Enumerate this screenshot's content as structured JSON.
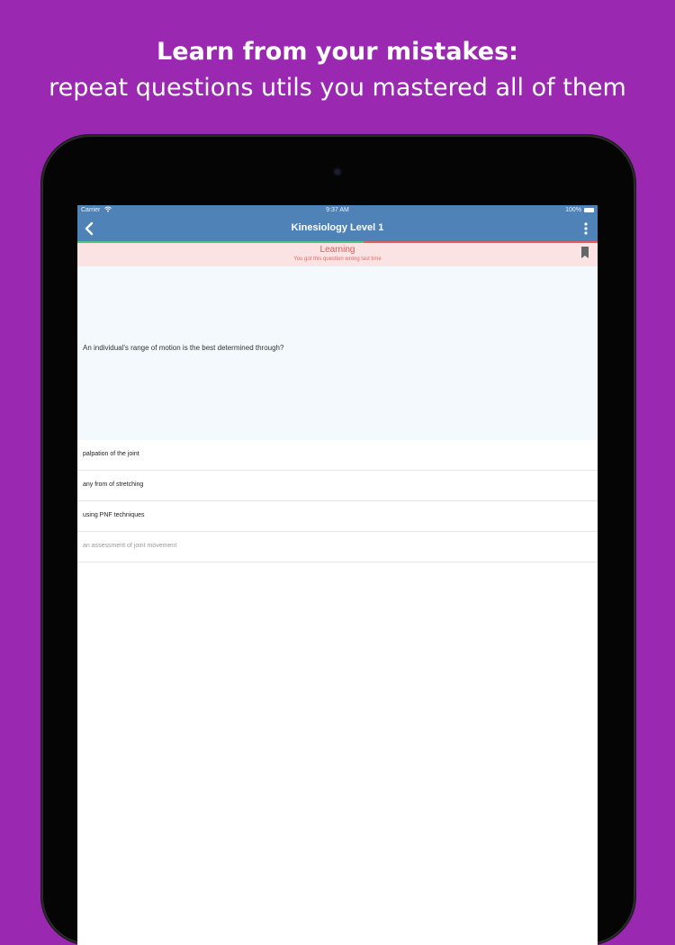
{
  "headline": {
    "title": "Learn from your mistakes:",
    "subtitle": "repeat questions utils you mastered all of them"
  },
  "status_bar": {
    "carrier": "Carrier",
    "wifi_icon": "wifi-icon",
    "time": "9:37 AM",
    "battery": "100%"
  },
  "nav": {
    "back_icon": "chevron-left-icon",
    "title": "Kinesiology Level 1",
    "more_icon": "more-vertical-icon"
  },
  "progress": {
    "fraction": 0.55,
    "done_color": "#49c58b",
    "remaining_color": "#e65a5a"
  },
  "banner": {
    "label": "Learning",
    "message": "You got this question wrong last time",
    "bookmark_icon": "bookmark-icon"
  },
  "question": {
    "text": "An individual's range of motion is the best determined through?"
  },
  "answers": [
    {
      "text": "palpation of the joint"
    },
    {
      "text": "any from of stretching"
    },
    {
      "text": "using PNF techniques"
    },
    {
      "text": "an assessment of joint movement"
    }
  ],
  "colors": {
    "background": "#9a28b0",
    "nav_bar": "#4f83b8",
    "banner": "#fbe3e3",
    "banner_text": "#e05a5a"
  }
}
